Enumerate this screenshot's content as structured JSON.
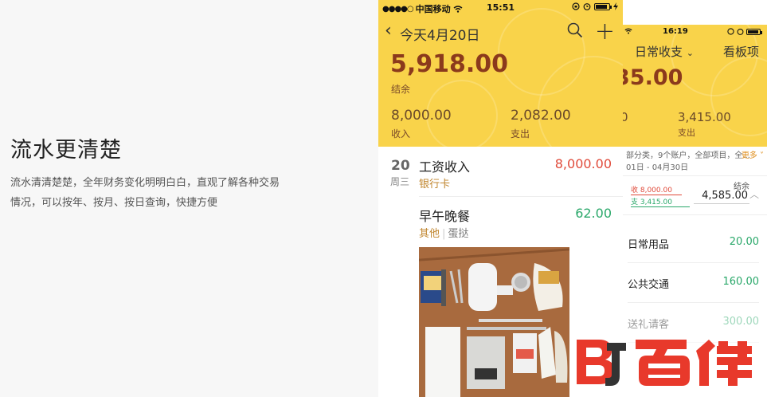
{
  "promo": {
    "title": "流水更清楚",
    "desc_line1": "流水清清楚楚，全年财务变化明明白白，直观了解各种交易",
    "desc_line2": "情况，可以按年、按月、按日查询，快捷方便"
  },
  "phone1": {
    "status": {
      "carrier": "中国移动",
      "time": "15:51"
    },
    "nav": {
      "title": "今天4月20日"
    },
    "balance": "5,918.00",
    "balance_label": "结余",
    "income": "8,000.00",
    "income_label": "收入",
    "expense": "2,082.00",
    "expense_label": "支出",
    "day": {
      "num": "20",
      "week": "周三"
    },
    "transactions": [
      {
        "title": "工资收入",
        "amount": "8,000.00",
        "category": "银行卡",
        "extra": ""
      },
      {
        "title": "早午晚餐",
        "amount": "62.00",
        "category": "其他",
        "extra": "蛋挞"
      }
    ]
  },
  "phone2": {
    "status": {
      "time": "16:19"
    },
    "nav": {
      "title": "日常收支",
      "right": "看板项"
    },
    "balance": "35.00",
    "income": "0",
    "expense": "3,415.00",
    "expense_label": "支出",
    "filter": "部分类，9个账户，全部项目，全...",
    "more": "更多",
    "range": "01日 - 04月30日",
    "summary": {
      "income": "收 8,000.00",
      "expense": "支 3,415.00",
      "label": "结余",
      "value": "4,585.00"
    },
    "rows": [
      {
        "label": "日常用品",
        "value": "20.00"
      },
      {
        "label": "公共交通",
        "value": "160.00"
      },
      {
        "label": "送礼请客",
        "value": "300.00"
      }
    ]
  },
  "colors": {
    "header_yellow": "#f9d34a",
    "balance_brown": "#8b3a1c",
    "income_red": "#e04a3a",
    "expense_green": "#2aa86a"
  }
}
